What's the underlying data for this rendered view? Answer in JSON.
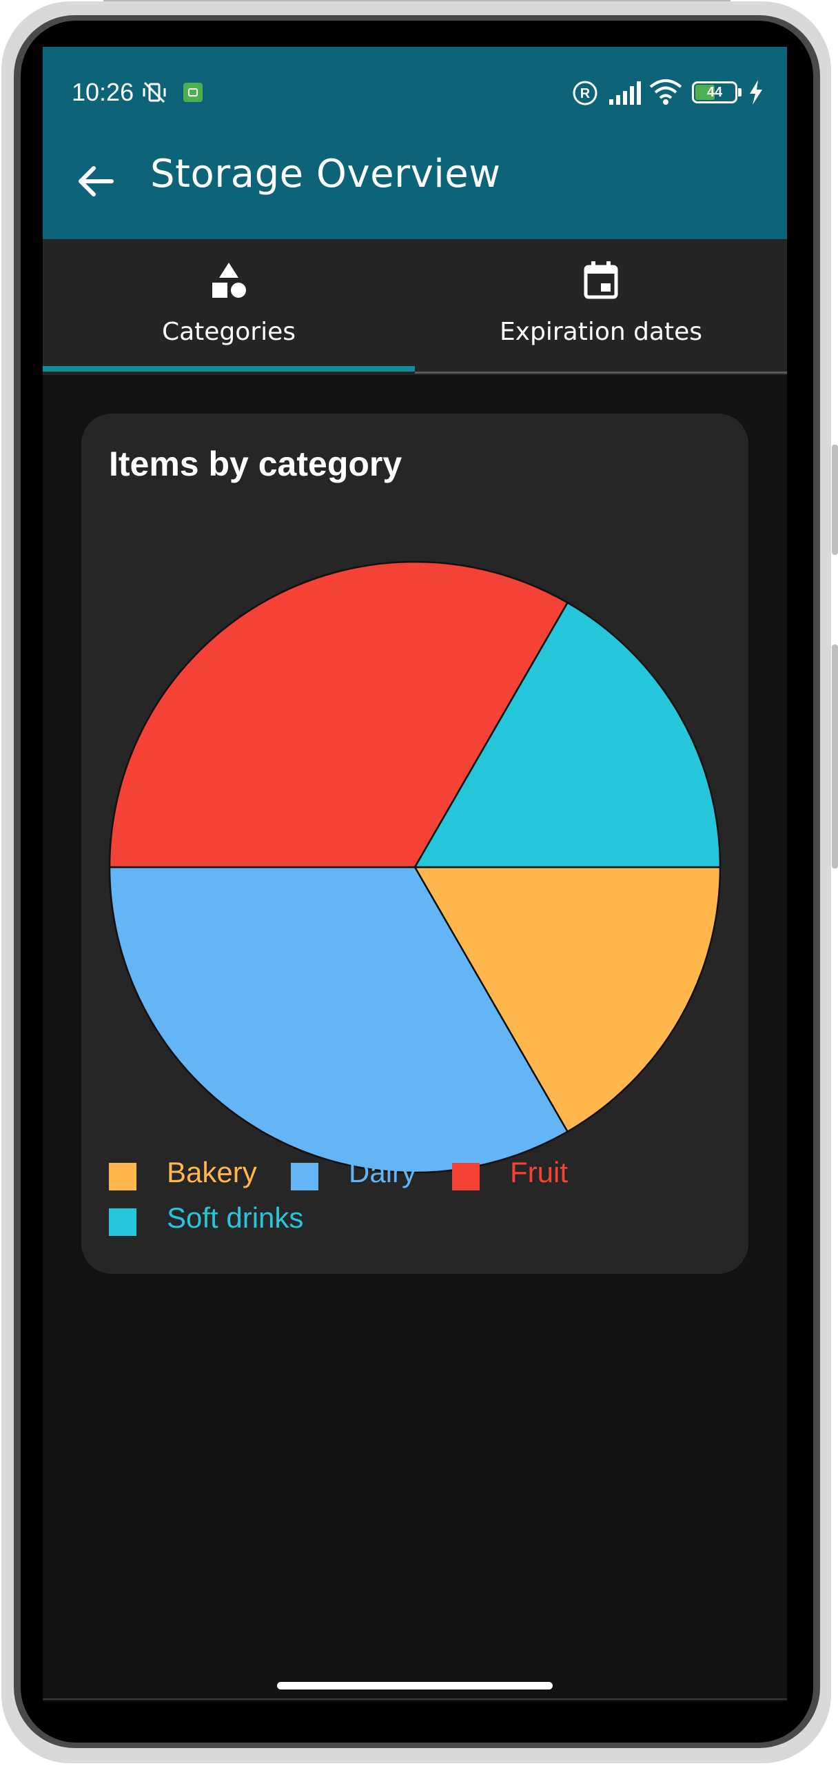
{
  "status_bar": {
    "time": "10:26",
    "battery": "44"
  },
  "toolbar": {
    "title": "Storage Overview"
  },
  "tabs": [
    {
      "label": "Categories",
      "selected": true
    },
    {
      "label": "Expiration dates",
      "selected": false
    }
  ],
  "card": {
    "title": "Items by category"
  },
  "colors": {
    "appbar": "#0d6478",
    "tab_indicator": "#138c9e",
    "bakery": "#ffb74d",
    "dairy": "#64b5f6",
    "fruit": "#f44336",
    "soft_drinks": "#26c6da"
  },
  "chart_data": {
    "type": "pie",
    "categories": [
      "Bakery",
      "Dairy",
      "Fruit",
      "Soft drinks"
    ],
    "values": [
      1,
      2,
      2,
      1
    ],
    "colors": [
      "#ffb74d",
      "#64b5f6",
      "#f44336",
      "#26c6da"
    ],
    "legend_position": "bottom-left"
  }
}
